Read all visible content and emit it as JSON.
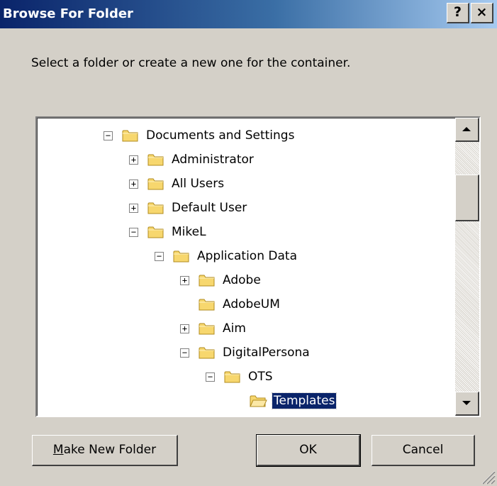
{
  "window": {
    "title": "Browse For Folder",
    "help_glyph": "?",
    "close_glyph": "×"
  },
  "instruction": "Select a folder or create a new one for the container.",
  "tree": {
    "items": [
      {
        "label": "Documents and Settings",
        "expander": "minus",
        "level": 0,
        "selected": false
      },
      {
        "label": "Administrator",
        "expander": "plus",
        "level": 1,
        "selected": false
      },
      {
        "label": "All Users",
        "expander": "plus",
        "level": 1,
        "selected": false
      },
      {
        "label": "Default User",
        "expander": "plus",
        "level": 1,
        "selected": false
      },
      {
        "label": "MikeL",
        "expander": "minus",
        "level": 1,
        "selected": false
      },
      {
        "label": "Application Data",
        "expander": "minus",
        "level": 2,
        "selected": false
      },
      {
        "label": "Adobe",
        "expander": "plus",
        "level": 3,
        "selected": false
      },
      {
        "label": "AdobeUM",
        "expander": "none",
        "level": 3,
        "selected": false
      },
      {
        "label": "Aim",
        "expander": "plus",
        "level": 3,
        "selected": false
      },
      {
        "label": "DigitalPersona",
        "expander": "minus",
        "level": 3,
        "selected": false
      },
      {
        "label": "OTS",
        "expander": "minus",
        "level": 4,
        "selected": false
      },
      {
        "label": "Templates",
        "expander": "none",
        "level": 5,
        "selected": true
      }
    ],
    "scroll_position": 0.25
  },
  "buttons": {
    "make_new_folder": {
      "accel": "M",
      "rest": "ake New Folder"
    },
    "ok": "OK",
    "cancel": "Cancel"
  },
  "colors": {
    "face": "#d4d0c8",
    "title_start": "#0a246a",
    "title_end": "#a6caf0",
    "selection": "#0a246a",
    "folder": "#f7d76e"
  }
}
